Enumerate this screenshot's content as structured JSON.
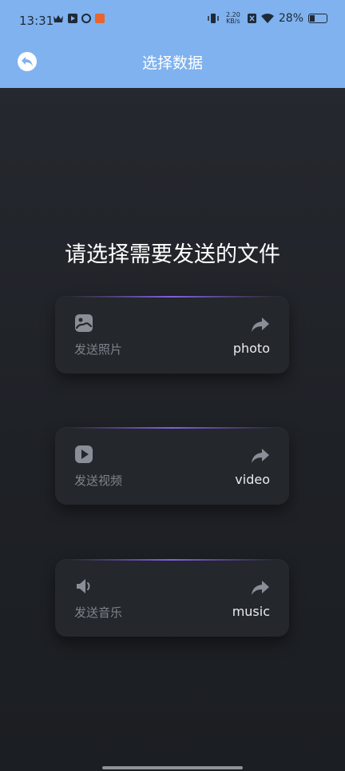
{
  "status_bar": {
    "time": "13:31",
    "speed_top": "2.20",
    "speed_unit": "KB/s",
    "battery": "28%"
  },
  "header": {
    "title": "选择数据",
    "back_icon": "back-arrow-icon"
  },
  "main": {
    "title": "请选择需要发送的文件",
    "cards": [
      {
        "label_zh": "发送照片",
        "label_en": "photo",
        "icon": "image-icon"
      },
      {
        "label_zh": "发送视频",
        "label_en": "video",
        "icon": "video-play-icon"
      },
      {
        "label_zh": "发送音乐",
        "label_en": "music",
        "icon": "speaker-icon"
      }
    ]
  },
  "colors": {
    "header_bg": "#7fb2ef",
    "page_bg": "#1e2126",
    "card_bg": "#24272c",
    "card_accent": "#8c64f0"
  }
}
